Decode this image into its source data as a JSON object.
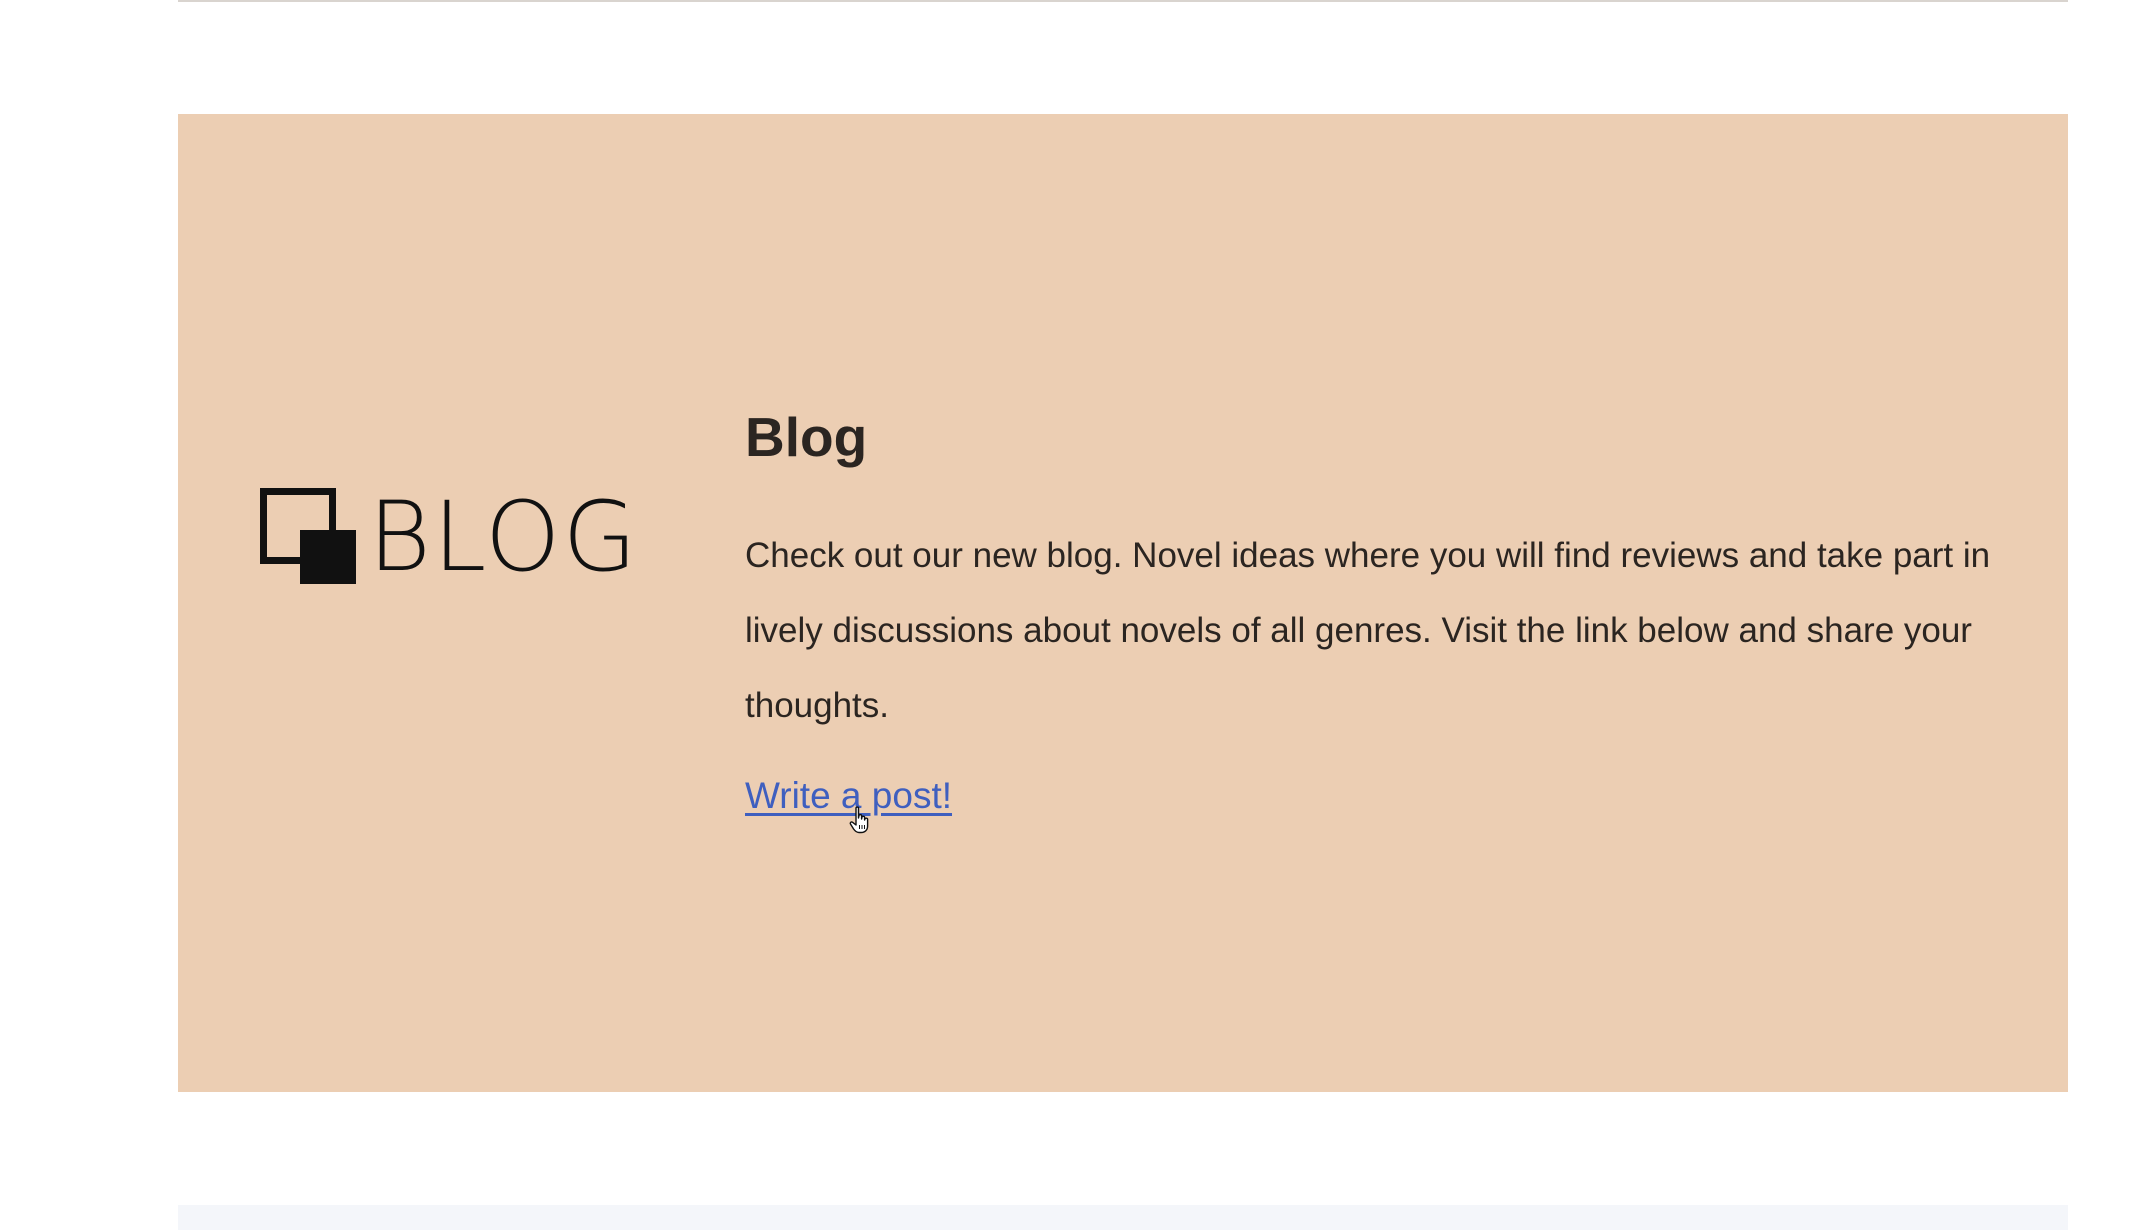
{
  "blog": {
    "logo_text": "BLOG",
    "title": "Blog",
    "description": "Check out our new blog. Novel ideas where you will find reviews and take part in lively discussions about novels of all genres. Visit the link below and share your thoughts.",
    "link_label": "Write a post!"
  },
  "colors": {
    "section_background": "#ecceb3",
    "text": "#2b2521",
    "link": "#3f5fbf"
  },
  "icons": {
    "logo": "overlapping-squares-icon",
    "cursor": "hand-pointer-icon"
  }
}
